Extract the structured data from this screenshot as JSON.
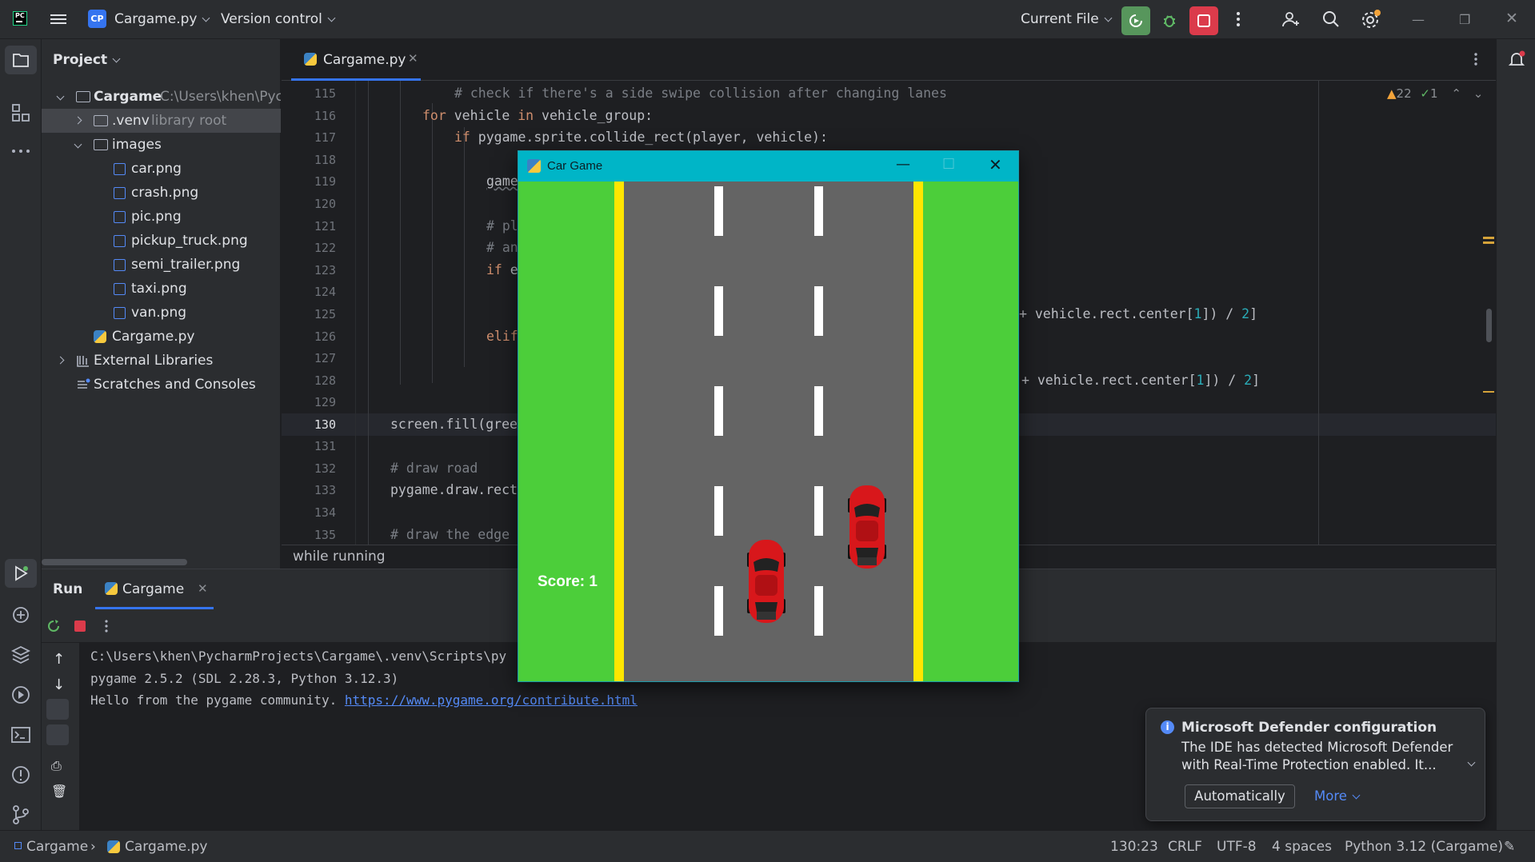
{
  "topbar": {
    "project_badge": "CP",
    "project_name": "Cargame.py",
    "vcs_label": "Version control",
    "run_config": "Current File",
    "icons": [
      "hamburger-icon",
      "run-icon",
      "debug-icon",
      "stop-icon",
      "more-icon",
      "add-user-icon",
      "search-icon",
      "settings-icon"
    ]
  },
  "project_panel": {
    "title": "Project",
    "tree": [
      {
        "label": "Cargame",
        "hint": "C:\\Users\\khen\\PycharmProjects\\Cargame",
        "type": "folder",
        "expanded": true
      },
      {
        "label": ".venv",
        "hint": "library root",
        "type": "folder",
        "expanded": false,
        "selected": true
      },
      {
        "label": "images",
        "type": "folder",
        "expanded": true
      },
      {
        "label": "car.png",
        "type": "image"
      },
      {
        "label": "crash.png",
        "type": "image"
      },
      {
        "label": "pic.png",
        "type": "image"
      },
      {
        "label": "pickup_truck.png",
        "type": "image"
      },
      {
        "label": "semi_trailer.png",
        "type": "image"
      },
      {
        "label": "taxi.png",
        "type": "image"
      },
      {
        "label": "van.png",
        "type": "image"
      },
      {
        "label": "Cargame.py",
        "type": "python"
      },
      {
        "label": "External Libraries",
        "type": "library"
      },
      {
        "label": "Scratches and Consoles",
        "type": "scratches"
      }
    ]
  },
  "editor": {
    "tab_label": "Cargame.py",
    "inspections": {
      "warnings": "22",
      "checks": "1"
    },
    "line_numbers": [
      "115",
      "116",
      "117",
      "118",
      "119",
      "120",
      "121",
      "122",
      "123",
      "124",
      "125",
      "126",
      "127",
      "128",
      "129",
      "130",
      "131",
      "132",
      "133",
      "134",
      "135"
    ],
    "current_line": "130",
    "lines": {
      "l115": "# check if there's a side swipe collision after changing lanes",
      "l116_kw": "for",
      "l116_a": " vehicle ",
      "l116_kw2": "in",
      "l116_b": " vehicle_group:",
      "l117_kw": "if",
      "l117_b": " pygame.sprite.collide_rect(player, vehicle):",
      "l119": "game",
      "l121": "# pl",
      "l122": "# an",
      "l123_kw": "if",
      "l123_b": " e",
      "l125_a": "+ vehicle.rect.center[",
      "l125_n1": "1",
      "l125_b": "]) / ",
      "l125_n2": "2",
      "l125_c": "]",
      "l126": "elif",
      "l128_a": "+ vehicle.rect.center[",
      "l128_n1": "1",
      "l128_b": "]) / ",
      "l128_n2": "2",
      "l128_c": "]",
      "l130": "screen.fill(gree",
      "l132": "# draw road",
      "l133": "pygame.draw.rect",
      "l135": "# draw the edge"
    },
    "status_text": "while running"
  },
  "run_panel": {
    "title": "Run",
    "tab_label": "Cargame",
    "console": [
      "C:\\Users\\khen\\PycharmProjects\\Cargame\\.venv\\Scripts\\py",
      "pygame 2.5.2 (SDL 2.28.3, Python 3.12.3)",
      "Hello from the pygame community. "
    ],
    "console_link": "https://www.pygame.org/contribute.html"
  },
  "game_window": {
    "title": "Car Game",
    "score_label": "Score: 1",
    "colors": {
      "grass": "#4cce3a",
      "road": "#646464",
      "edge": "#ffe600",
      "lane": "#ffffff",
      "car": "#d8171b"
    }
  },
  "notification": {
    "title": "Microsoft Defender configuration",
    "body": "The IDE has detected Microsoft Defender with Real-Time Protection enabled. It...",
    "button": "Automatically",
    "more": "More"
  },
  "statusbar": {
    "crumb_project": "Cargame",
    "crumb_file": "Cargame.py",
    "position": "130:23",
    "line_sep": "CRLF",
    "encoding": "UTF-8",
    "indent": "4 spaces",
    "interpreter": "Python 3.12 (Cargame)"
  },
  "accent": "#3574f0"
}
